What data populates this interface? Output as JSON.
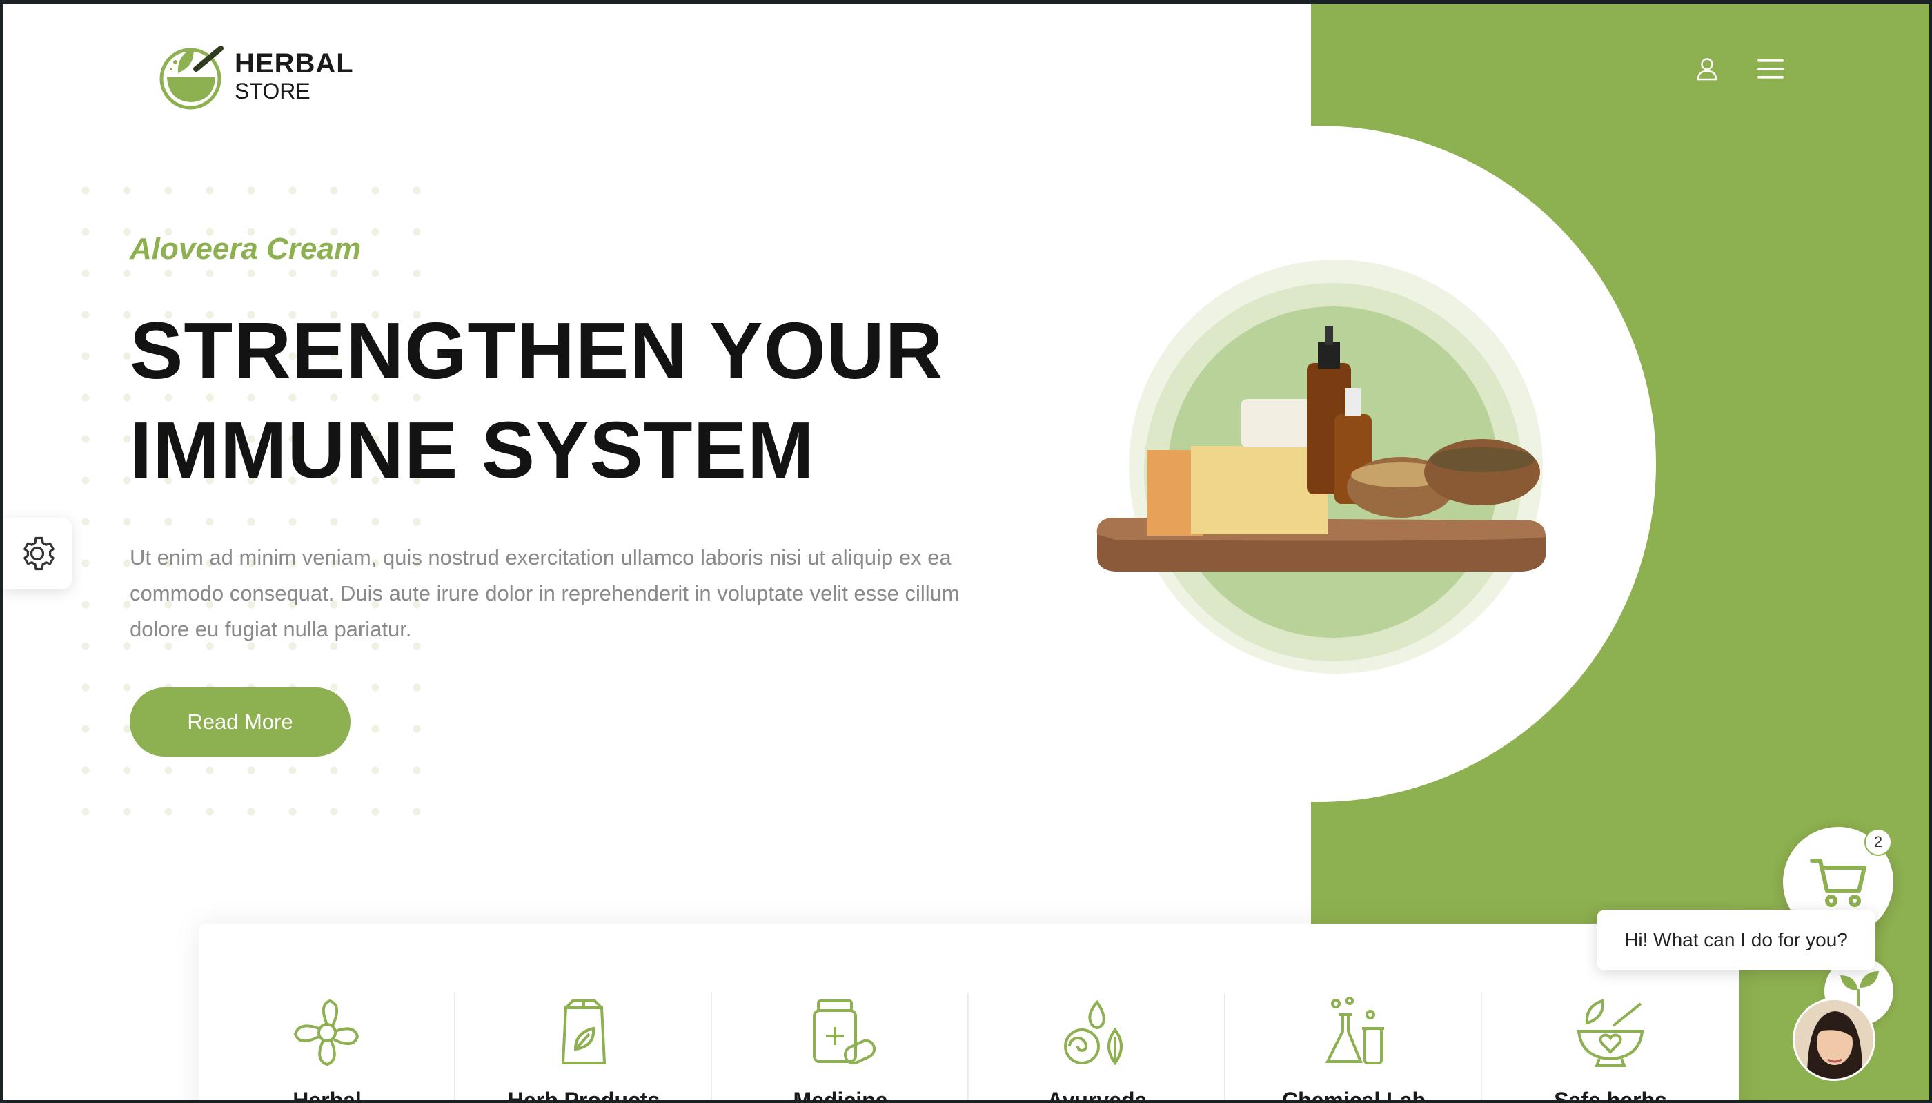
{
  "brand": {
    "line1": "HERBAL",
    "line2": "STORE",
    "accent": "#8db050"
  },
  "header": {
    "icons": [
      "user-icon",
      "menu-icon"
    ]
  },
  "hero": {
    "subtitle": "Aloveera Cream",
    "title": "STRENGTHEN YOUR IMMUNE SYSTEM",
    "description": "Ut enim ad minim veniam, quis nostrud exercitation ullamco laboris nisi ut aliquip ex ea commodo consequat. Duis aute irure dolor in reprehenderit in voluptate velit esse cillum dolore eu fugiat nulla pariatur.",
    "button_label": "Read More"
  },
  "categories": [
    {
      "icon": "flower-icon",
      "label": "Herbal"
    },
    {
      "icon": "tea-bag-icon",
      "label": "Herb Products"
    },
    {
      "icon": "medicine-icon",
      "label": "Medicine"
    },
    {
      "icon": "ayurveda-icon",
      "label": "Ayurveda"
    },
    {
      "icon": "chemical-lab-icon",
      "label": "Chemical Lab"
    },
    {
      "icon": "mortar-icon",
      "label": "Safe herbs"
    }
  ],
  "cart": {
    "count": "2"
  },
  "chat": {
    "greeting": "Hi! What can I do for you?"
  }
}
